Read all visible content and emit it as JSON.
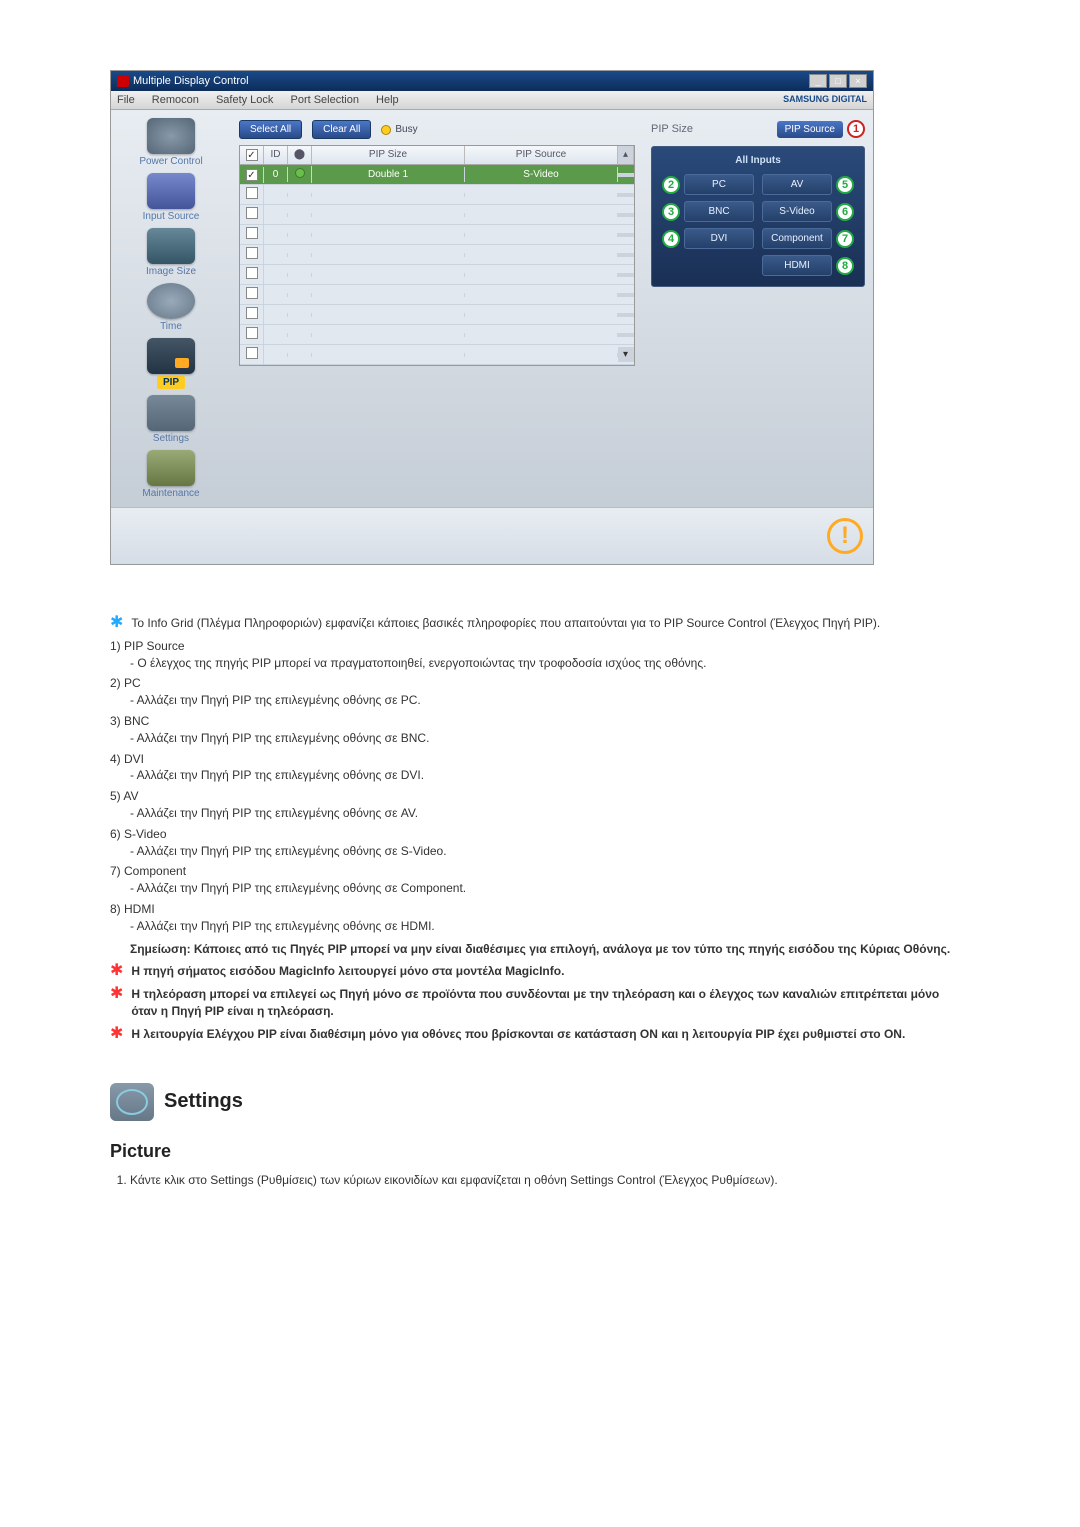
{
  "app": {
    "title": "Multiple Display Control",
    "menu": {
      "file": "File",
      "remocon": "Remocon",
      "safety": "Safety Lock",
      "port": "Port Selection",
      "help": "Help"
    },
    "brand": "SAMSUNG DIGITAL"
  },
  "sidebar": {
    "power": "Power Control",
    "input": "Input Source",
    "image": "Image Size",
    "time": "Time",
    "pip": "PIP",
    "settings": "Settings",
    "maint": "Maintenance"
  },
  "toolbar": {
    "select_all": "Select All",
    "clear_all": "Clear All",
    "busy": "Busy"
  },
  "grid": {
    "head": {
      "id": "ID",
      "pip_size": "PIP Size",
      "pip_source": "PIP Source"
    },
    "rows": [
      {
        "id": "0",
        "size": "Double 1",
        "source": "S-Video",
        "checked": true,
        "selected": true
      }
    ]
  },
  "right": {
    "pip_size": "PIP Size",
    "pip_source": "PIP Source",
    "all_inputs": "All Inputs",
    "pc": "PC",
    "av": "AV",
    "bnc": "BNC",
    "svideo": "S-Video",
    "dvi": "DVI",
    "component": "Component",
    "hdmi": "HDMI"
  },
  "doc": {
    "intro": "Το Info Grid (Πλέγμα Πληροφοριών) εμφανίζει κάποιες βασικές πληροφορίες που απαιτούνται για το PIP Source Control (Έλεγχος Πηγή PIP).",
    "items": [
      {
        "n": "1)",
        "title": "PIP Source",
        "desc": "- Ο έλεγχος της πηγής PIP μπορεί να πραγματοποιηθεί, ενεργοποιώντας την τροφοδοσία ισχύος της οθόνης."
      },
      {
        "n": "2)",
        "title": "PC",
        "desc": "- Αλλάζει την Πηγή PIP της επιλεγμένης οθόνης σε PC."
      },
      {
        "n": "3)",
        "title": "BNC",
        "desc": "- Αλλάζει την Πηγή PIP της επιλεγμένης οθόνης σε BNC."
      },
      {
        "n": "4)",
        "title": "DVI",
        "desc": "- Αλλάζει την Πηγή PIP της επιλεγμένης οθόνης σε DVI."
      },
      {
        "n": "5)",
        "title": "AV",
        "desc": "- Αλλάζει την Πηγή PIP της επιλεγμένης οθόνης σε AV."
      },
      {
        "n": "6)",
        "title": "S-Video",
        "desc": "- Αλλάζει την Πηγή PIP της επιλεγμένης οθόνης σε S-Video."
      },
      {
        "n": "7)",
        "title": "Component",
        "desc": "- Αλλάζει την Πηγή PIP της επιλεγμένης οθόνης σε Component."
      },
      {
        "n": "8)",
        "title": "HDMI",
        "desc": "- Αλλάζει την Πηγή PIP της επιλεγμένης οθόνης σε HDMI."
      }
    ],
    "note": "Σημείωση: Κάποιες από τις Πηγές PIP μπορεί να μην είναι διαθέσιμες για επιλογή, ανάλογα με τον τύπο της πηγής εισόδου της Κύριας Οθόνης.",
    "stars": [
      "Η πηγή σήματος εισόδου MagicInfo λειτουργεί μόνο στα μοντέλα MagicInfo.",
      "Η τηλεόραση μπορεί να επιλεγεί ως Πηγή μόνο σε προϊόντα που συνδέονται με την τηλεόραση και ο έλεγχος των καναλιών επιτρέπεται μόνο όταν η Πηγή PIP είναι η τηλεόραση.",
      "Η λειτουργία Ελέγχου PIP είναι διαθέσιμη μόνο για οθόνες που βρίσκονται σε κατάσταση ON και η λειτουργία PIP έχει ρυθμιστεί στο ON."
    ],
    "settings_heading": "Settings",
    "picture_heading": "Picture",
    "picture_step1": "Κάντε κλικ στο Settings (Ρυθμίσεις) των κύριων εικονιδίων και εμφανίζεται η οθόνη Settings Control (Έλεγχος Ρυθμίσεων)."
  }
}
